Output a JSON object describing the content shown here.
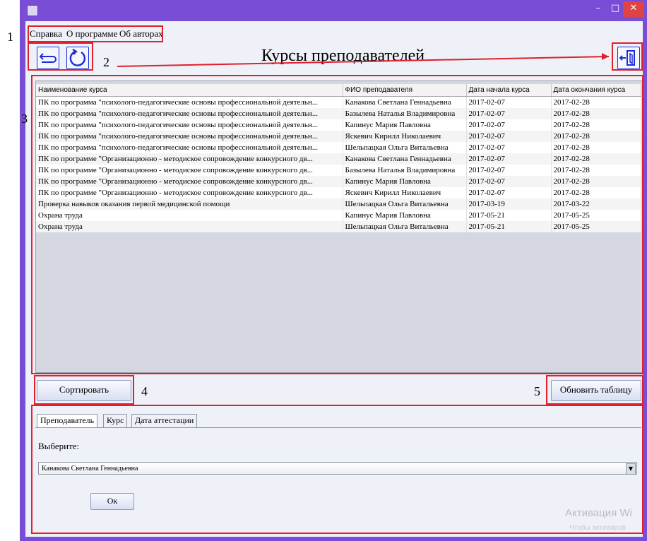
{
  "window": {
    "minimize_glyph": "–",
    "maximize_glyph": "□",
    "close_glyph": "✕",
    "titlebar_color": "#7a4dd6"
  },
  "menu": {
    "items": [
      "Справка",
      "О программе",
      "Об авторах"
    ]
  },
  "callouts": [
    "1",
    "2",
    "3",
    "4",
    "5"
  ],
  "toolbar": {
    "back_icon": "back-arrow-icon",
    "refresh_icon": "refresh-icon",
    "exit_icon": "exit-door-icon"
  },
  "page": {
    "title": "Курсы преподавателей"
  },
  "table": {
    "columns": [
      "Наименование курса",
      "ФИО преподавателя",
      "Дата начала курса",
      "Дата окончания курса"
    ],
    "rows": [
      [
        "ПК по программа \"психолого-педагогические основы профессиональной деятельн...",
        "Канакова Светлана Геннадьевна",
        "2017-02-07",
        "2017-02-28"
      ],
      [
        "ПК по программа \"психолого-педагогические основы профессиональной деятельн...",
        "Базылева Наталья Владимировна",
        "2017-02-07",
        "2017-02-28"
      ],
      [
        "ПК по программа \"психолого-педагогические основы профессиональной деятельн...",
        "Капинус Мария Павловна",
        "2017-02-07",
        "2017-02-28"
      ],
      [
        "ПК по программа \"психолого-педагогические основы профессиональной деятельн...",
        "Яскевич Кирилл Николаевич",
        "2017-02-07",
        "2017-02-28"
      ],
      [
        "ПК по программа \"психолого-педагогические основы профессиональной деятельн...",
        "Шельпацкая Ольга Витальевна",
        "2017-02-07",
        "2017-02-28"
      ],
      [
        "ПК по программе \"Организационно - методиское сопровождение конкурсного дв...",
        "Канакова Светлана Геннадьевна",
        "2017-02-07",
        "2017-02-28"
      ],
      [
        "ПК по программе \"Организационно - методиское сопровождение конкурсного дв...",
        "Базылева Наталья Владимировна",
        "2017-02-07",
        "2017-02-28"
      ],
      [
        "ПК по программе \"Организационно - методиское сопровождение конкурсного дв...",
        "Капинус Мария Павловна",
        "2017-02-07",
        "2017-02-28"
      ],
      [
        "ПК по программе \"Организационно - методиское сопровождение конкурсного дв...",
        "Яскевич Кирилл Николаевич",
        "2017-02-07",
        "2017-02-28"
      ],
      [
        "Проверка навыков оказания первой медицинской помощи",
        "Шельпацкая Ольга Витальевна",
        "2017-03-19",
        "2017-03-22"
      ],
      [
        "Охрана труда",
        "Капинус Мария Павловна",
        "2017-05-21",
        "2017-05-25"
      ],
      [
        "Охрана труда",
        "Шельпацкая Ольга Витальевна",
        "2017-05-21",
        "2017-05-25"
      ]
    ]
  },
  "buttons": {
    "sort": "Сортировать",
    "refresh_table": "Обновить таблицу",
    "ok": "Ок"
  },
  "tabs": [
    "Преподаватель",
    "Курс",
    "Дата аттестации"
  ],
  "filter": {
    "label": "Выберите:",
    "selected": "Канакова Светлана Геннадьевна",
    "arrow_glyph": "▼"
  },
  "watermark": {
    "line1": "Активация Wi",
    "line2": "Чтобы активиров"
  },
  "colors": {
    "annotation_red": "#e0202a",
    "icon_blue": "#1c2ad9"
  }
}
